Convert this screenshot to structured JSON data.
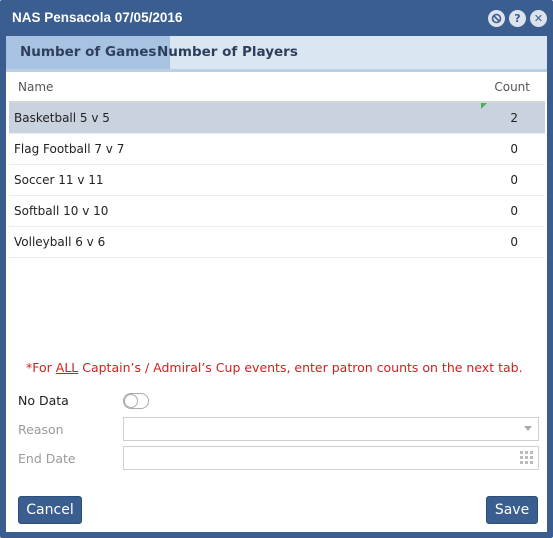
{
  "dialog": {
    "title": "NAS Pensacola 07/05/2016",
    "icons": [
      "block-icon",
      "help-icon",
      "close-icon"
    ]
  },
  "tabs": [
    {
      "label": "Number of Games",
      "active": true
    },
    {
      "label": "Number of Players",
      "active": false
    }
  ],
  "grid": {
    "columns": {
      "name": "Name",
      "count": "Count"
    },
    "rows": [
      {
        "name": "Basketball 5 v 5",
        "count": "2",
        "selected": true
      },
      {
        "name": "Flag Football 7 v 7",
        "count": "0"
      },
      {
        "name": "Soccer 11 v 11",
        "count": "0"
      },
      {
        "name": "Softball 10 v 10",
        "count": "0"
      },
      {
        "name": "Volleyball 6 v 6",
        "count": "0"
      }
    ]
  },
  "notice": {
    "prefix": "*For ",
    "underlined": "ALL",
    "suffix": " Captain’s / Admiral’s Cup events, enter patron counts on the next tab."
  },
  "form": {
    "no_data_label": "No Data",
    "no_data_value": false,
    "reason_label": "Reason",
    "reason_value": "",
    "end_date_label": "End Date",
    "end_date_value": ""
  },
  "buttons": {
    "cancel": "Cancel",
    "save": "Save"
  },
  "colors": {
    "primary": "#3b5e91",
    "notice": "#d0211d",
    "tab_active": "#a8c3e2"
  }
}
